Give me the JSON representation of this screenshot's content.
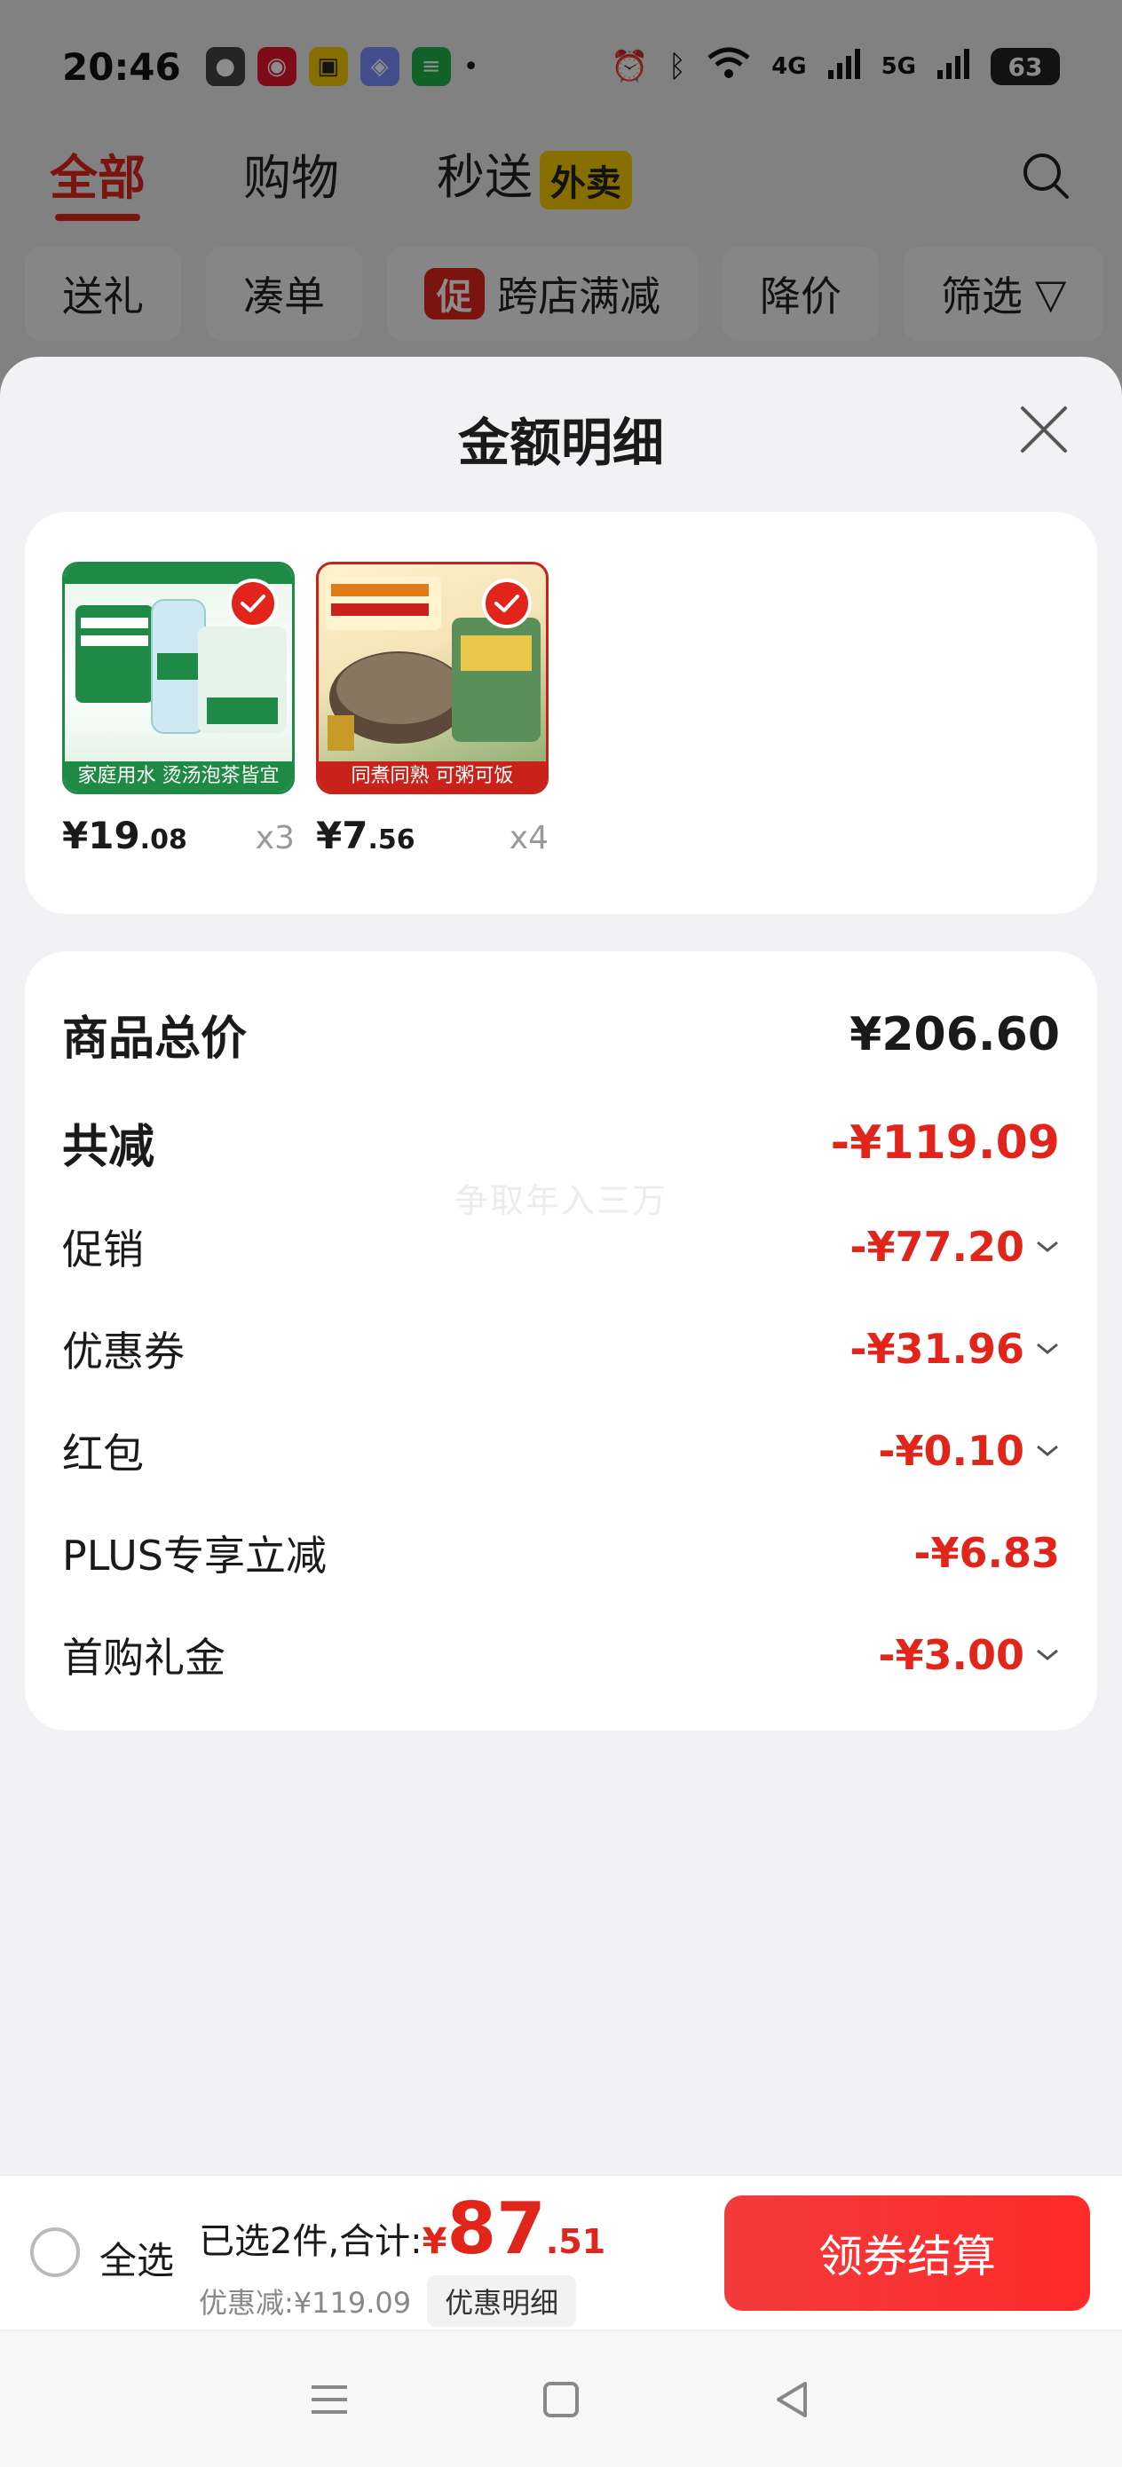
{
  "status_bar": {
    "time": "20:46",
    "battery": "63",
    "network_1": "4G",
    "network_2": "5G"
  },
  "background": {
    "tabs": [
      {
        "label": "全部",
        "active": true
      },
      {
        "label": "购物",
        "active": false
      },
      {
        "label": "秒送",
        "active": false
      }
    ],
    "waimai_badge": "外卖",
    "chips": [
      "送礼",
      "凑单",
      "跨店满减",
      "降价",
      "筛选"
    ],
    "promo_tag": "促"
  },
  "sheet": {
    "title": "金额明细",
    "products": [
      {
        "name": "water",
        "price_int": "¥19",
        "price_dec": ".08",
        "qty": "x3",
        "banner": "家庭用水 烫汤泡茶皆宜"
      },
      {
        "name": "rice",
        "price_int": "¥7",
        "price_dec": ".56",
        "qty": "x4",
        "banner": "同煮同熟 可粥可饭"
      }
    ],
    "watermark": "争取年入三万",
    "total_label": "商品总价",
    "total_value": "¥206.60",
    "reduce_label": "共减",
    "reduce_value": "-¥119.09",
    "items": [
      {
        "label": "促销",
        "value": "-¥77.20",
        "expandable": true
      },
      {
        "label": "优惠券",
        "value": "-¥31.96",
        "expandable": true
      },
      {
        "label": "红包",
        "value": "-¥0.10",
        "expandable": true
      },
      {
        "label": "PLUS专享立减",
        "value": "-¥6.83",
        "expandable": false
      },
      {
        "label": "首购礼金",
        "value": "-¥3.00",
        "expandable": true
      }
    ]
  },
  "bottom_bar": {
    "select_all": "全选",
    "summary_prefix": "已选2件,合计:",
    "currency": "¥",
    "total_int": "87",
    "total_dec": ".51",
    "discount_text": "优惠减:¥119.09",
    "detail_button": "优惠明细",
    "checkout_button": "领券结算"
  },
  "colors": {
    "accent": "#e1251b",
    "waimai": "#f5c800"
  }
}
